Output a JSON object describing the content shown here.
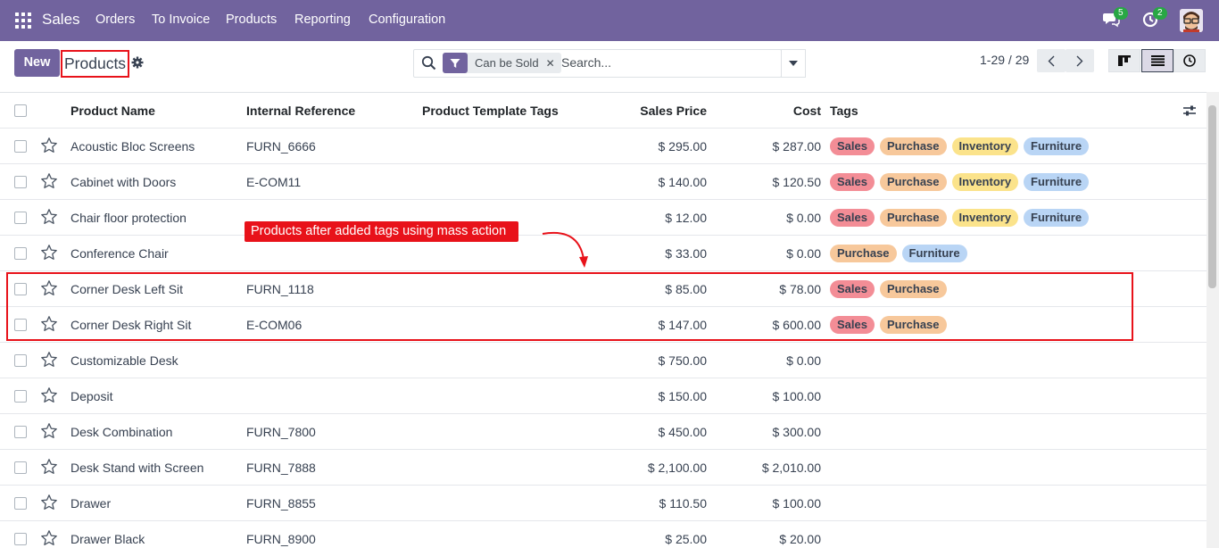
{
  "navbar": {
    "app_name": "Sales",
    "menu": [
      "Orders",
      "To Invoice",
      "Products",
      "Reporting",
      "Configuration"
    ],
    "messages_count": "5",
    "activities_count": "2"
  },
  "control_panel": {
    "new_label": "New",
    "breadcrumb": "Products",
    "facet_label": "Can be Sold",
    "search_placeholder": "Search...",
    "pager": "1-29 / 29"
  },
  "table": {
    "columns": [
      "Product Name",
      "Internal Reference",
      "Product Template Tags",
      "Sales Price",
      "Cost",
      "Tags"
    ],
    "rows": [
      {
        "name": "Acoustic Bloc Screens",
        "ref": "FURN_6666",
        "price": "$ 295.00",
        "cost": "$ 287.00",
        "tags": [
          "Sales",
          "Purchase",
          "Inventory",
          "Furniture"
        ]
      },
      {
        "name": "Cabinet with Doors",
        "ref": "E-COM11",
        "price": "$ 140.00",
        "cost": "$ 120.50",
        "tags": [
          "Sales",
          "Purchase",
          "Inventory",
          "Furniture"
        ]
      },
      {
        "name": "Chair floor protection",
        "ref": "",
        "price": "$ 12.00",
        "cost": "$ 0.00",
        "tags": [
          "Sales",
          "Purchase",
          "Inventory",
          "Furniture"
        ]
      },
      {
        "name": "Conference Chair",
        "ref": "",
        "price": "$ 33.00",
        "cost": "$ 0.00",
        "tags": [
          "Purchase",
          "Furniture"
        ]
      },
      {
        "name": "Corner Desk Left Sit",
        "ref": "FURN_1118",
        "price": "$ 85.00",
        "cost": "$ 78.00",
        "tags": [
          "Sales",
          "Purchase"
        ]
      },
      {
        "name": "Corner Desk Right Sit",
        "ref": "E-COM06",
        "price": "$ 147.00",
        "cost": "$ 600.00",
        "tags": [
          "Sales",
          "Purchase"
        ]
      },
      {
        "name": "Customizable Desk",
        "ref": "",
        "price": "$ 750.00",
        "cost": "$ 0.00",
        "tags": []
      },
      {
        "name": "Deposit",
        "ref": "",
        "price": "$ 150.00",
        "cost": "$ 100.00",
        "tags": []
      },
      {
        "name": "Desk Combination",
        "ref": "FURN_7800",
        "price": "$ 450.00",
        "cost": "$ 300.00",
        "tags": []
      },
      {
        "name": "Desk Stand with Screen",
        "ref": "FURN_7888",
        "price": "$ 2,100.00",
        "cost": "$ 2,010.00",
        "tags": []
      },
      {
        "name": "Drawer",
        "ref": "FURN_8855",
        "price": "$ 110.50",
        "cost": "$ 100.00",
        "tags": []
      },
      {
        "name": "Drawer Black",
        "ref": "FURN_8900",
        "price": "$ 25.00",
        "cost": "$ 20.00",
        "tags": []
      }
    ]
  },
  "tag_colors": {
    "Sales": "#f38d96",
    "Purchase": "#f7c89b",
    "Inventory": "#fbe38b",
    "Furniture": "#b9d5f5"
  },
  "annotation": {
    "text": "Products after added tags using mass action"
  },
  "colors": {
    "brand": "#71639e",
    "highlight": "#e8121a"
  }
}
